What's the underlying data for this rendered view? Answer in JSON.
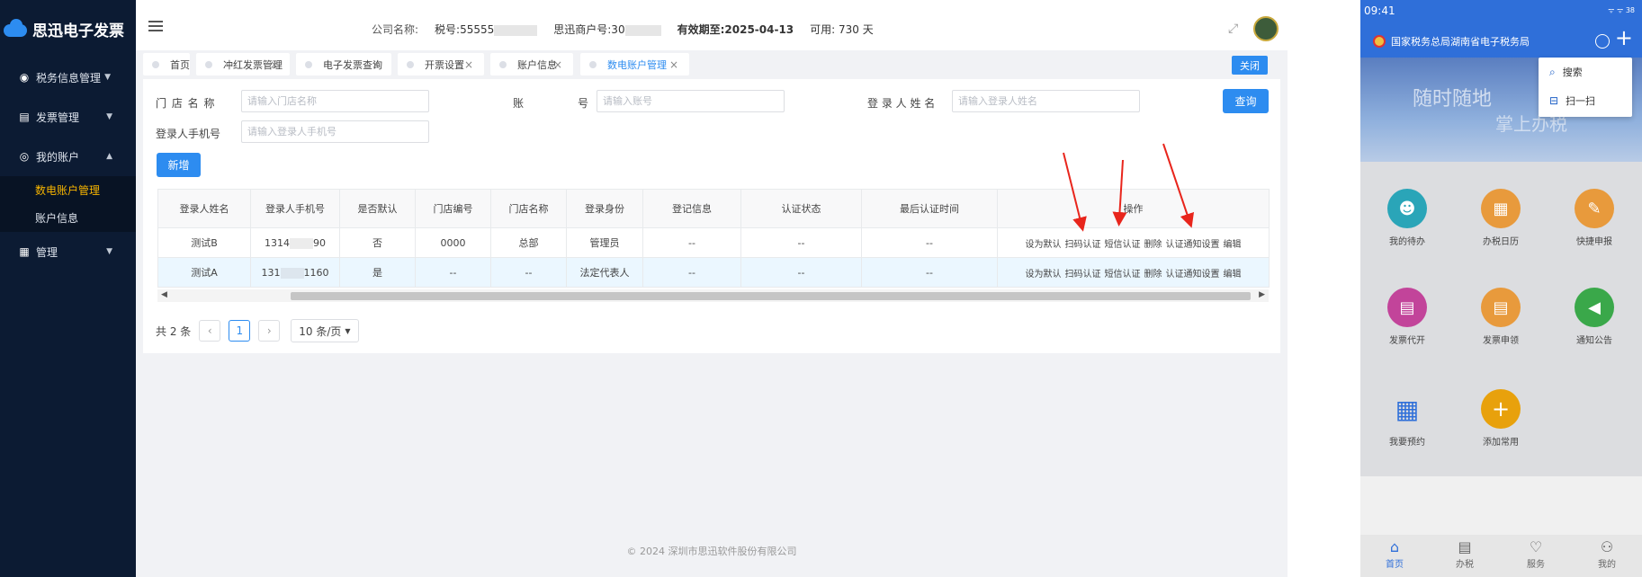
{
  "sidebar": {
    "logo": "思迅电子发票",
    "menu": [
      {
        "label": "税务信息管理",
        "icon": "target-icon"
      },
      {
        "label": "发票管理",
        "icon": "invoice-icon"
      },
      {
        "label": "我的账户",
        "icon": "user-circle-icon"
      }
    ],
    "sub_items": [
      "数电账户管理",
      "账户信息"
    ],
    "manage": {
      "label": "管理",
      "icon": "grid-icon"
    }
  },
  "header": {
    "company_label": "公司名称:",
    "tax_no": "税号:55555",
    "merchant_no": "思迅商户号:30",
    "valid_until": "有效期至:2025-04-13",
    "available": "可用: 730 天"
  },
  "tabs": [
    {
      "label": "首页",
      "closable": false
    },
    {
      "label": "冲红发票管理",
      "closable": true
    },
    {
      "label": "电子发票查询",
      "closable": true
    },
    {
      "label": "开票设置",
      "closable": true
    },
    {
      "label": "账户信息",
      "closable": true
    },
    {
      "label": "数电账户管理",
      "closable": true,
      "active": true
    }
  ],
  "close_label": "关闭",
  "search": {
    "store_name_label": "门 店 名 称",
    "store_name_placeholder": "请输入门店名称",
    "account_label_a": "账",
    "account_label_b": "号",
    "account_placeholder": "请输入账号",
    "login_name_label": "登 录 人 姓 名",
    "login_name_placeholder": "请输入登录人姓名",
    "phone_label": "登录人手机号",
    "phone_placeholder": "请输入登录人手机号",
    "query_button": "查询",
    "add_button": "新增"
  },
  "table": {
    "columns": [
      "登录人姓名",
      "登录人手机号",
      "是否默认",
      "门店编号",
      "门店名称",
      "登录身份",
      "登记信息",
      "认证状态",
      "最后认证时间",
      "操作"
    ],
    "rows": [
      [
        "测试B",
        "1314",
        "90",
        "否",
        "0000",
        "总部",
        "管理员",
        "--",
        "--",
        "--"
      ],
      [
        "测试A",
        "131",
        "1160",
        "是",
        "--",
        "--",
        "法定代表人",
        "--",
        "--",
        "--"
      ]
    ],
    "actions": [
      "设为默认",
      "扫码认证",
      "短信认证",
      "删除",
      "认证通知设置",
      "编辑"
    ]
  },
  "pager": {
    "total": "共 2 条",
    "prev": "‹",
    "page": "1",
    "next": "›",
    "size": "10 条/页"
  },
  "footer": "© 2024 深圳市思迅软件股份有限公司",
  "mobile": {
    "time": "09:41",
    "status_right": "ᯤ ᯤ 38",
    "title": "国家税务总局湖南省电子税务局",
    "banner_line1": "随时随地",
    "banner_line2": "掌上办税",
    "popup": [
      {
        "label": "搜索",
        "icon": "search-icon"
      },
      {
        "label": "扫一扫",
        "icon": "scan-icon"
      }
    ],
    "grid": [
      {
        "label": "我的待办",
        "color": "#2aa5b8"
      },
      {
        "label": "办税日历",
        "color": "#e89a3c"
      },
      {
        "label": "快捷申报",
        "color": "#e89a3c"
      },
      {
        "label": "发票代开",
        "color": "#c2449a"
      },
      {
        "label": "发票申领",
        "color": "#e89a3c"
      },
      {
        "label": "通知公告",
        "color": "#3aa84a"
      },
      {
        "label": "我要预约",
        "color": "#2f6fd9"
      },
      {
        "label": "添加常用",
        "color": "#e8a10c"
      }
    ],
    "nav": [
      {
        "label": "首页",
        "icon": "home-icon"
      },
      {
        "label": "办税",
        "icon": "document-icon"
      },
      {
        "label": "服务",
        "icon": "heart-icon"
      },
      {
        "label": "我的",
        "icon": "person-icon"
      }
    ]
  },
  "colors": {
    "primary": "#2d8cf0",
    "sidebar": "#0c1b33",
    "active_menu": "#f7b500",
    "arrow": "#e8251c"
  }
}
